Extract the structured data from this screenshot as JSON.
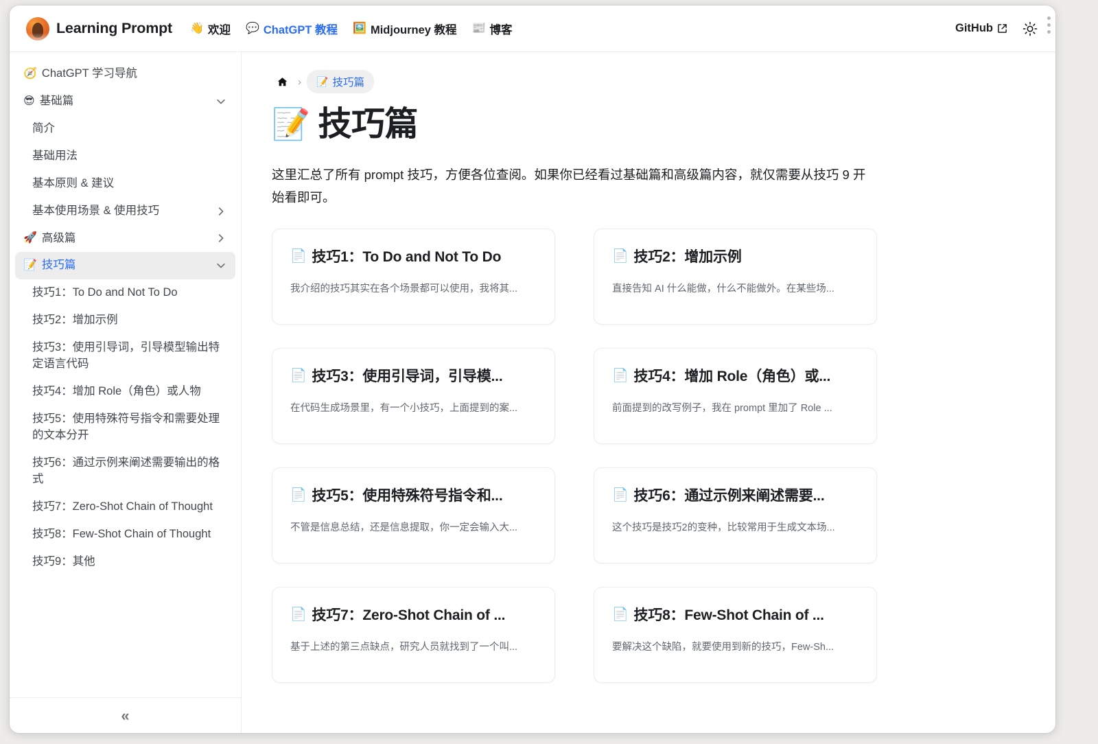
{
  "header": {
    "brand": {
      "name": "Learning Prompt",
      "logo_icon": "avatar-logo"
    },
    "nav_links": [
      {
        "emoji": "👋",
        "label": "欢迎",
        "active": false,
        "icon": "wave-icon"
      },
      {
        "emoji": "💬",
        "label": "ChatGPT 教程",
        "active": true,
        "icon": "speech-bubble-icon"
      },
      {
        "emoji": "🖼️",
        "label": "Midjourney 教程",
        "active": false,
        "icon": "picture-icon"
      },
      {
        "emoji": "📰",
        "label": "博客",
        "active": false,
        "icon": "newspaper-icon"
      }
    ],
    "github_label": "GitHub",
    "github_icon": "external-link-icon",
    "theme_icon": "sun-icon"
  },
  "sidebar": {
    "items": [
      {
        "emoji": "🧭",
        "label": "ChatGPT 学习导航",
        "level": 1,
        "chevron": "",
        "active": false
      },
      {
        "emoji": "😎",
        "label": "基础篇",
        "level": 1,
        "chevron": "down",
        "active": false
      },
      {
        "emoji": "",
        "label": "简介",
        "level": 2,
        "chevron": "",
        "active": false
      },
      {
        "emoji": "",
        "label": "基础用法",
        "level": 2,
        "chevron": "",
        "active": false
      },
      {
        "emoji": "",
        "label": "基本原则 & 建议",
        "level": 2,
        "chevron": "",
        "active": false
      },
      {
        "emoji": "",
        "label": "基本使用场景 & 使用技巧",
        "level": 2,
        "chevron": "right",
        "active": false
      },
      {
        "emoji": "🚀",
        "label": "高级篇",
        "level": 1,
        "chevron": "right",
        "active": false
      },
      {
        "emoji": "📝",
        "label": "技巧篇",
        "level": 1,
        "chevron": "down",
        "active": true
      },
      {
        "emoji": "",
        "label": "技巧1：To Do and Not To Do",
        "level": 2,
        "chevron": "",
        "active": false
      },
      {
        "emoji": "",
        "label": "技巧2：增加示例",
        "level": 2,
        "chevron": "",
        "active": false
      },
      {
        "emoji": "",
        "label": "技巧3：使用引导词，引导模型输出特定语言代码",
        "level": 2,
        "chevron": "",
        "active": false
      },
      {
        "emoji": "",
        "label": "技巧4：增加 Role（角色）或人物",
        "level": 2,
        "chevron": "",
        "active": false
      },
      {
        "emoji": "",
        "label": "技巧5：使用特殊符号指令和需要处理的文本分开",
        "level": 2,
        "chevron": "",
        "active": false
      },
      {
        "emoji": "",
        "label": "技巧6：通过示例来阐述需要输出的格式",
        "level": 2,
        "chevron": "",
        "active": false
      },
      {
        "emoji": "",
        "label": "技巧7：Zero-Shot Chain of Thought",
        "level": 2,
        "chevron": "",
        "active": false
      },
      {
        "emoji": "",
        "label": "技巧8：Few-Shot Chain of Thought",
        "level": 2,
        "chevron": "",
        "active": false
      },
      {
        "emoji": "",
        "label": "技巧9：其他",
        "level": 2,
        "chevron": "",
        "active": false
      }
    ],
    "collapse_glyph": "«"
  },
  "breadcrumb": {
    "home_icon": "home-icon",
    "separator": "›",
    "current": {
      "emoji": "📝",
      "label": "技巧篇"
    }
  },
  "page": {
    "title_emoji": "📝",
    "title": "技巧篇",
    "intro": "这里汇总了所有 prompt 技巧，方便各位查阅。如果你已经看过基础篇和高级篇内容，就仅需要从技巧 9 开始看即可。"
  },
  "cards": [
    {
      "emoji": "📄",
      "title": "技巧1：To Do and Not To Do",
      "desc": "我介绍的技巧其实在各个场景都可以使用，我将其..."
    },
    {
      "emoji": "📄",
      "title": "技巧2：增加示例",
      "desc": "直接告知 AI 什么能做，什么不能做外。在某些场..."
    },
    {
      "emoji": "📄",
      "title": "技巧3：使用引导词，引导模...",
      "desc": "在代码生成场景里，有一个小技巧，上面提到的案..."
    },
    {
      "emoji": "📄",
      "title": "技巧4：增加 Role（角色）或...",
      "desc": "前面提到的改写例子，我在 prompt 里加了 Role ..."
    },
    {
      "emoji": "📄",
      "title": "技巧5：使用特殊符号指令和...",
      "desc": "不管是信息总结，还是信息提取，你一定会输入大..."
    },
    {
      "emoji": "📄",
      "title": "技巧6：通过示例来阐述需要...",
      "desc": "这个技巧是技巧2的变种，比较常用于生成文本场..."
    },
    {
      "emoji": "📄",
      "title": "技巧7：Zero-Shot Chain of ...",
      "desc": "基于上述的第三点缺点，研究人员就找到了一个叫..."
    },
    {
      "emoji": "📄",
      "title": "技巧8：Few-Shot Chain of ...",
      "desc": "要解决这个缺陷，就要使用到新的技巧，Few-Sh..."
    }
  ],
  "colors": {
    "accent": "#2a6df4",
    "text": "#1c1e21",
    "muted": "#606770",
    "border": "#ececec",
    "active_bg": "#ededee"
  }
}
